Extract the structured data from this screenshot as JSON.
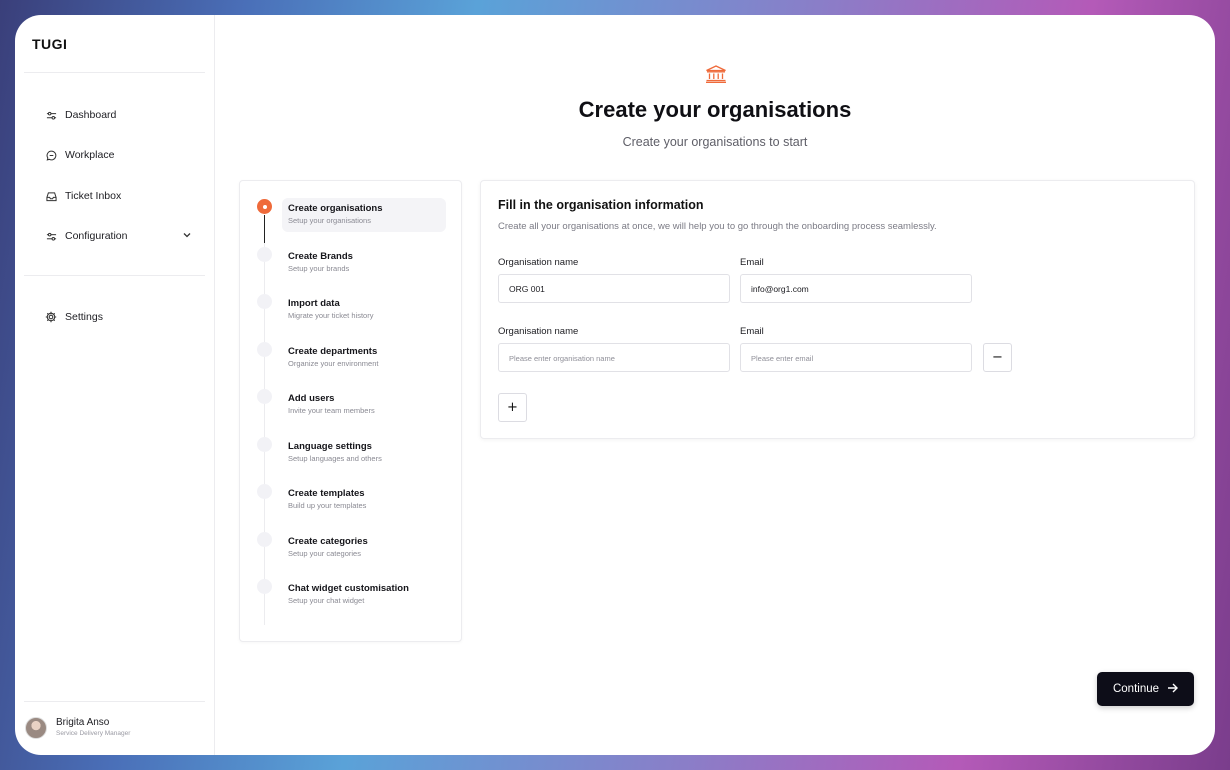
{
  "app": {
    "brand": "TUGI",
    "accent": "#ef6a3a"
  },
  "sidebar": {
    "items": [
      {
        "label": "Dashboard",
        "icon": "sliders-icon"
      },
      {
        "label": "Workplace",
        "icon": "chat-icon"
      },
      {
        "label": "Ticket Inbox",
        "icon": "inbox-icon"
      },
      {
        "label": "Configuration",
        "icon": "sliders-icon",
        "expandable": true
      }
    ],
    "settings": {
      "label": "Settings",
      "icon": "gear-icon"
    },
    "user": {
      "name": "Brigita Anso",
      "role": "Service Delivery Manager"
    }
  },
  "header": {
    "icon": "bank-icon",
    "title": "Create your organisations",
    "subtitle": "Create your organisations to start"
  },
  "steps": [
    {
      "title": "Create organisations",
      "desc": "Setup your organisations",
      "active": true
    },
    {
      "title": "Create Brands",
      "desc": "Setup your brands"
    },
    {
      "title": "Import data",
      "desc": "Migrate your ticket history"
    },
    {
      "title": "Create departments",
      "desc": "Organize your environment"
    },
    {
      "title": "Add users",
      "desc": "Invite your team members"
    },
    {
      "title": "Language settings",
      "desc": "Setup languages and others"
    },
    {
      "title": "Create templates",
      "desc": "Build up your templates"
    },
    {
      "title": "Create categories",
      "desc": "Setup your categories"
    },
    {
      "title": "Chat widget customisation",
      "desc": "Setup your chat widget"
    }
  ],
  "form": {
    "title": "Fill in the organisation information",
    "description": "Create all your organisations at once, we will help you to go through the onboarding process seamlessly.",
    "rows": [
      {
        "org_label": "Organisation name",
        "org_value": "ORG 001",
        "email_label": "Email",
        "email_value": "info@org1.com"
      },
      {
        "org_label": "Organisation name",
        "org_placeholder": "Please enter organisation name",
        "email_label": "Email",
        "email_placeholder": "Please enter email",
        "remove_label": "−"
      }
    ],
    "add_label": "+"
  },
  "actions": {
    "continue_label": "Continue",
    "continue_icon": "arrow-right-icon"
  }
}
